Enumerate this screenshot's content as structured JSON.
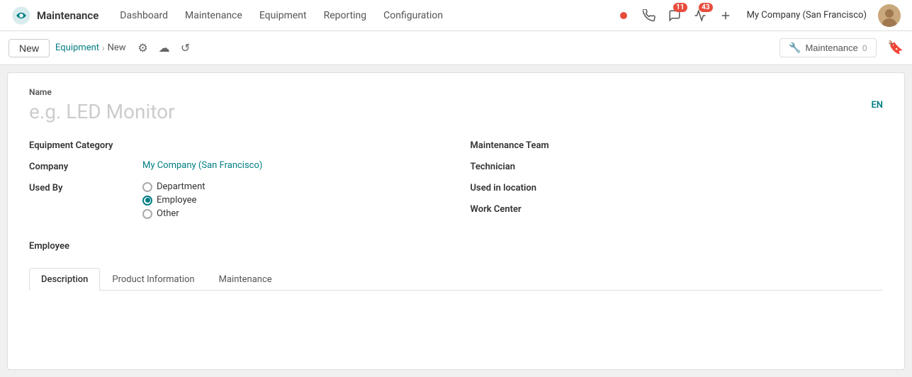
{
  "app": {
    "logo_label": "Maintenance",
    "nav_items": [
      {
        "label": "Dashboard",
        "active": false
      },
      {
        "label": "Maintenance",
        "active": false
      },
      {
        "label": "Equipment",
        "active": false
      },
      {
        "label": "Reporting",
        "active": false
      },
      {
        "label": "Configuration",
        "active": false
      }
    ],
    "company": "My Company (San Francisco)",
    "notifications": {
      "messages_count": "11",
      "activity_count": "43"
    }
  },
  "toolbar": {
    "new_label": "New",
    "breadcrumb_parent": "Equipment",
    "breadcrumb_current": "New",
    "maintenance_button_label": "Maintenance",
    "maintenance_count": "0"
  },
  "form": {
    "name_label": "Name",
    "name_placeholder": "e.g. LED Monitor",
    "lang_badge": "EN",
    "equipment_category_label": "Equipment Category",
    "company_label": "Company",
    "company_value": "My Company (San Francisco)",
    "used_by_label": "Used By",
    "used_by_options": [
      {
        "label": "Department",
        "checked": false
      },
      {
        "label": "Employee",
        "checked": true
      },
      {
        "label": "Other",
        "checked": false
      }
    ],
    "maintenance_team_label": "Maintenance Team",
    "technician_label": "Technician",
    "used_in_location_label": "Used in location",
    "work_center_label": "Work Center",
    "employee_label": "Employee",
    "tabs": [
      {
        "label": "Description",
        "active": true
      },
      {
        "label": "Product Information",
        "active": false
      },
      {
        "label": "Maintenance",
        "active": false
      }
    ]
  }
}
